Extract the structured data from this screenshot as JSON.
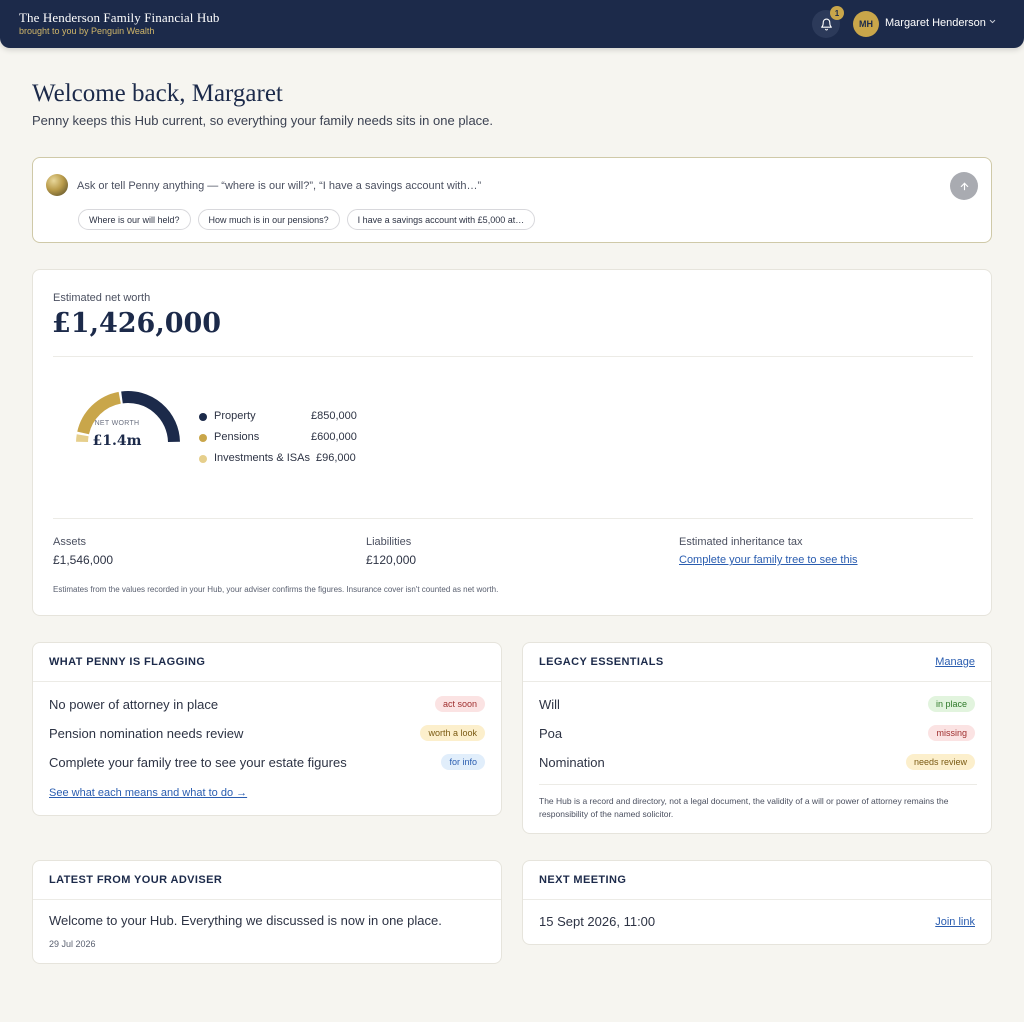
{
  "header": {
    "title": "The Henderson Family Financial Hub",
    "subtitle": "brought to you by Penguin Wealth",
    "notification_count": "1",
    "avatar_initials": "MH",
    "user_name": "Margaret Henderson"
  },
  "welcome": {
    "title": "Welcome back, Margaret",
    "subtitle": "Penny keeps this Hub current, so everything your family needs sits in one place."
  },
  "ask": {
    "placeholder": "Ask or tell Penny anything — “where is our will?”, “I have a savings account with…”",
    "suggestions": [
      "Where is our will held?",
      "How much is in our pensions?",
      "I have a savings account with £5,000 at…"
    ]
  },
  "net_worth": {
    "label": "Estimated net worth",
    "value": "£1,426,000",
    "donut_label": "NET WORTH",
    "donut_value": "£1.4m",
    "breakdown": [
      {
        "name": "Property",
        "value": "£850,000",
        "amount": 850000,
        "color": "#1c2a4a"
      },
      {
        "name": "Pensions",
        "value": "£600,000",
        "amount": 600000,
        "color": "#c9a64a"
      },
      {
        "name": "Investments & ISAs",
        "value": "£96,000",
        "amount": 96000,
        "color": "#e6cf8c"
      }
    ],
    "assets_label": "Assets",
    "assets_value": "£1,546,000",
    "liabilities_label": "Liabilities",
    "liabilities_value": "£120,000",
    "iht_label": "Estimated inheritance tax",
    "iht_link": "Complete your family tree to see this",
    "note": "Estimates from the values recorded in your Hub, your adviser confirms the figures. Insurance cover isn't counted as net worth."
  },
  "flagging": {
    "title": "WHAT PENNY IS FLAGGING",
    "items": [
      {
        "text": "No power of attorney in place",
        "tag": "act soon"
      },
      {
        "text": "Pension nomination needs review",
        "tag": "worth a look"
      },
      {
        "text": "Complete your family tree to see your estate figures",
        "tag": "for info"
      }
    ],
    "link": "See what each means and what to do →"
  },
  "legacy": {
    "title": "LEGACY ESSENTIALS",
    "manage": "Manage",
    "items": [
      {
        "text": "Will",
        "tag": "in place"
      },
      {
        "text": "Poa",
        "tag": "missing"
      },
      {
        "text": "Nomination",
        "tag": "needs review"
      }
    ],
    "note": "The Hub is a record and directory, not a legal document, the validity of a will or power of attorney remains the responsibility of the named solicitor."
  },
  "adviser": {
    "title": "LATEST FROM YOUR ADVISER",
    "message": "Welcome to your Hub. Everything we discussed is now in one place.",
    "date": "29 Jul 2026"
  },
  "meeting": {
    "title": "NEXT MEETING",
    "datetime": "15 Sept 2026, 11:00",
    "link": "Join link"
  }
}
